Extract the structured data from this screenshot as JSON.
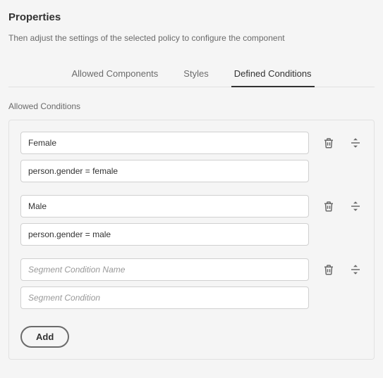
{
  "header": {
    "title": "Properties",
    "subtitle": "Then adjust the settings of the selected policy to configure the component"
  },
  "tabs": [
    {
      "label": "Allowed Components",
      "active": false
    },
    {
      "label": "Styles",
      "active": false
    },
    {
      "label": "Defined Conditions",
      "active": true
    }
  ],
  "section": {
    "label": "Allowed Conditions"
  },
  "conditions": [
    {
      "name": "Female",
      "expression": "person.gender = female"
    },
    {
      "name": "Male",
      "expression": "person.gender = male"
    },
    {
      "name": "",
      "expression": ""
    }
  ],
  "placeholders": {
    "name": "Segment Condition Name",
    "expression": "Segment Condition"
  },
  "buttons": {
    "add": "Add"
  }
}
